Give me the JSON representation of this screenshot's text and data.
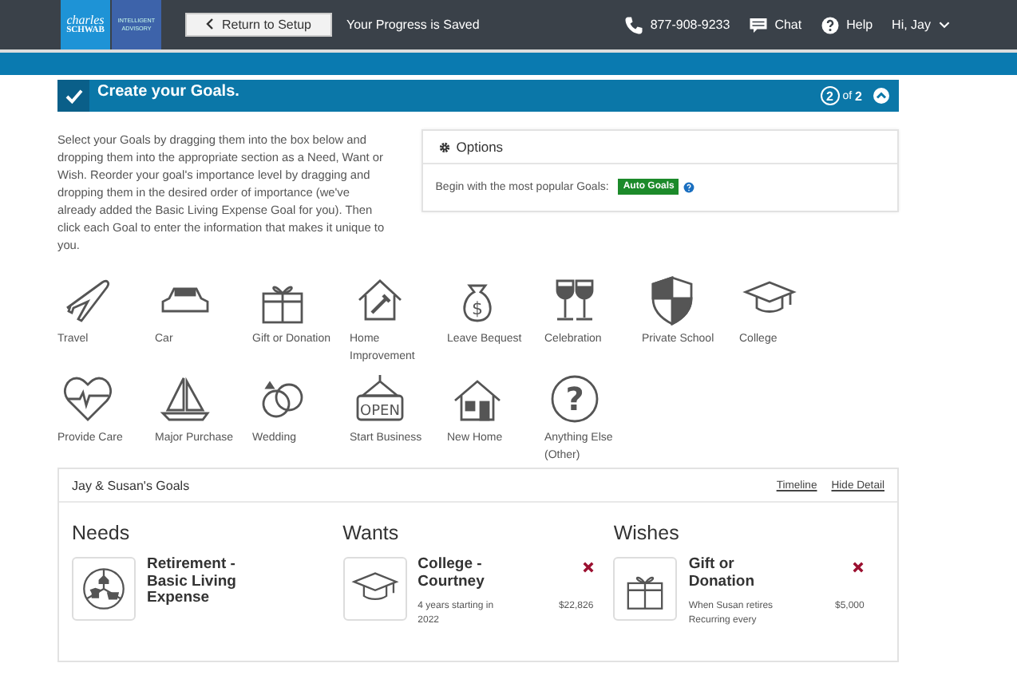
{
  "header": {
    "logo_top": "charles",
    "logo_bottom": "SCHWAB",
    "badge_top": "INTELLIGENT",
    "badge_bottom": "ADVISORY",
    "back_button": "Return to Setup",
    "status": "Your Progress is Saved",
    "phone": "877-908-9233",
    "chat": "Chat",
    "help": "Help",
    "user": "Hi, Jay"
  },
  "step": {
    "title": "Create your Goals.",
    "current": "2",
    "of": "of",
    "total": "2"
  },
  "instructions": "Select your Goals by dragging them into the box below and dropping them into the appropriate section as a Need, Want or Wish. Reorder your goal's importance level by dragging and dropping them in the desired order of importance (we've already added the Basic Living Expense Goal for you). Then click each Goal to enter the information that makes it unique to you.",
  "options": {
    "title": "Options",
    "text": "Begin with the most popular Goals:",
    "button": "Auto Goals"
  },
  "goal_types": [
    {
      "label": "Travel"
    },
    {
      "label": "Car"
    },
    {
      "label": "Gift or Donation"
    },
    {
      "label": "Home Improvement"
    },
    {
      "label": "Leave Bequest",
      "icon_text": "$"
    },
    {
      "label": "Celebration"
    },
    {
      "label": "Private School"
    },
    {
      "label": "College"
    },
    {
      "label": "Provide Care"
    },
    {
      "label": "Major Purchase"
    },
    {
      "label": "Wedding"
    },
    {
      "label": "Start Business",
      "icon_text": "OPEN"
    },
    {
      "label": "New Home"
    },
    {
      "label": "Anything Else (Other)",
      "icon_text": "?"
    }
  ],
  "goals_panel": {
    "title": "Jay & Susan's Goals",
    "links": [
      "Timeline",
      "Hide Detail"
    ],
    "sections": [
      {
        "title": "Needs",
        "cards": [
          {
            "title": "Retirement - Basic Living Expense",
            "removable": false
          }
        ]
      },
      {
        "title": "Wants",
        "cards": [
          {
            "title": "College - Courtney",
            "removable": true,
            "details": [
              {
                "text": "4 years starting in 2022",
                "amount": "$22,826"
              }
            ]
          }
        ]
      },
      {
        "title": "Wishes",
        "cards": [
          {
            "title": "Gift or Donation",
            "removable": true,
            "details": [
              {
                "text": "When Susan retires Recurring every",
                "amount": "$5,000"
              }
            ]
          }
        ]
      }
    ]
  }
}
